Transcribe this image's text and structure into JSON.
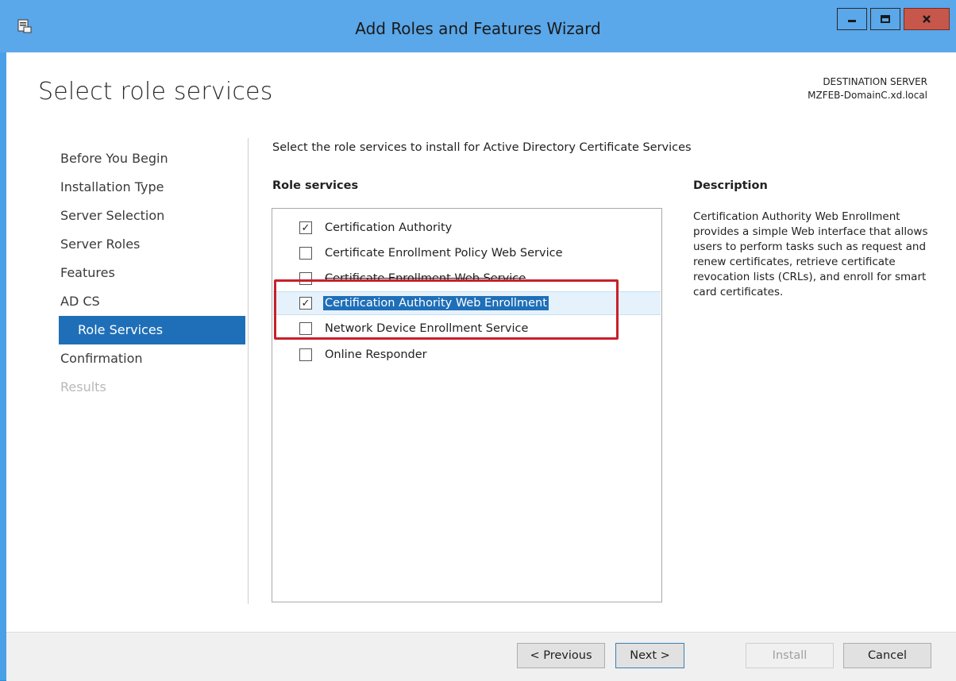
{
  "window": {
    "title": "Add Roles and Features Wizard",
    "minimize_glyph": "▬",
    "maximize_glyph": "□",
    "close_glyph": "x"
  },
  "page": {
    "title": "Select role services",
    "destination_label": "DESTINATION SERVER",
    "destination_server": "MZFEB-DomainC.xd.local"
  },
  "nav": {
    "items": [
      {
        "label": "Before You Begin",
        "state": "normal"
      },
      {
        "label": "Installation Type",
        "state": "normal"
      },
      {
        "label": "Server Selection",
        "state": "normal"
      },
      {
        "label": "Server Roles",
        "state": "normal"
      },
      {
        "label": "Features",
        "state": "normal"
      },
      {
        "label": "AD CS",
        "state": "normal"
      },
      {
        "label": "Role Services",
        "state": "active"
      },
      {
        "label": "Confirmation",
        "state": "normal"
      },
      {
        "label": "Results",
        "state": "disabled"
      }
    ]
  },
  "main": {
    "intro": "Select the role services to install for Active Directory Certificate Services",
    "role_services_header": "Role services",
    "description_header": "Description",
    "description": "Certification Authority Web Enrollment provides a simple Web interface that allows users to perform tasks such as request and renew certificates, retrieve certificate revocation lists (CRLs), and enroll for smart card certificates.",
    "role_services": [
      {
        "label": "Certification Authority",
        "checked": true,
        "selected": false
      },
      {
        "label": "Certificate Enrollment Policy Web Service",
        "checked": false,
        "selected": false
      },
      {
        "label": "Certificate Enrollment Web Service",
        "checked": false,
        "selected": false
      },
      {
        "label": "Certification Authority Web Enrollment",
        "checked": true,
        "selected": true
      },
      {
        "label": "Network Device Enrollment Service",
        "checked": false,
        "selected": false
      },
      {
        "label": "Online Responder",
        "checked": false,
        "selected": false
      }
    ],
    "check_glyph": "✓"
  },
  "footer": {
    "previous_label": "< Previous",
    "next_label": "Next >",
    "install_label": "Install",
    "cancel_label": "Cancel"
  },
  "colors": {
    "titlebar": "#5aa7e9",
    "accent": "#1f6fb8",
    "highlight_box": "#c8202a",
    "close_button": "#c7574a"
  }
}
